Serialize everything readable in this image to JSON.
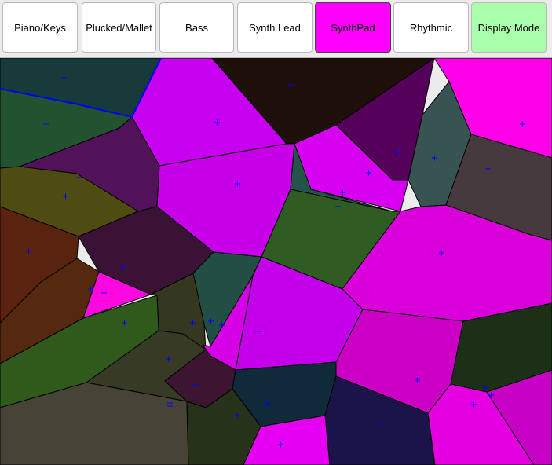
{
  "toolbar": {
    "buttons": [
      {
        "id": "piano",
        "label": "Piano/Keys",
        "bg": "#ffffff",
        "active": false
      },
      {
        "id": "plucked",
        "label": "Plucked/Mallet",
        "bg": "#ffffff",
        "active": false
      },
      {
        "id": "bass",
        "label": "Bass",
        "bg": "#ffffff",
        "active": false
      },
      {
        "id": "synthlead",
        "label": "Synth Lead",
        "bg": "#ffffff",
        "active": false
      },
      {
        "id": "synthpad",
        "label": "SynthPad",
        "bg": "#ff00ff",
        "active": true
      },
      {
        "id": "rhythmic",
        "label": "Rhythmic",
        "bg": "#ffffff",
        "active": false
      },
      {
        "id": "display",
        "label": "Display Mode",
        "bg": "#aaffaa",
        "active": false
      }
    ]
  },
  "canvas": {
    "marker_color": "#0000ff",
    "edge_color": "#000000",
    "highlight_edge_color": "#0000ff"
  }
}
